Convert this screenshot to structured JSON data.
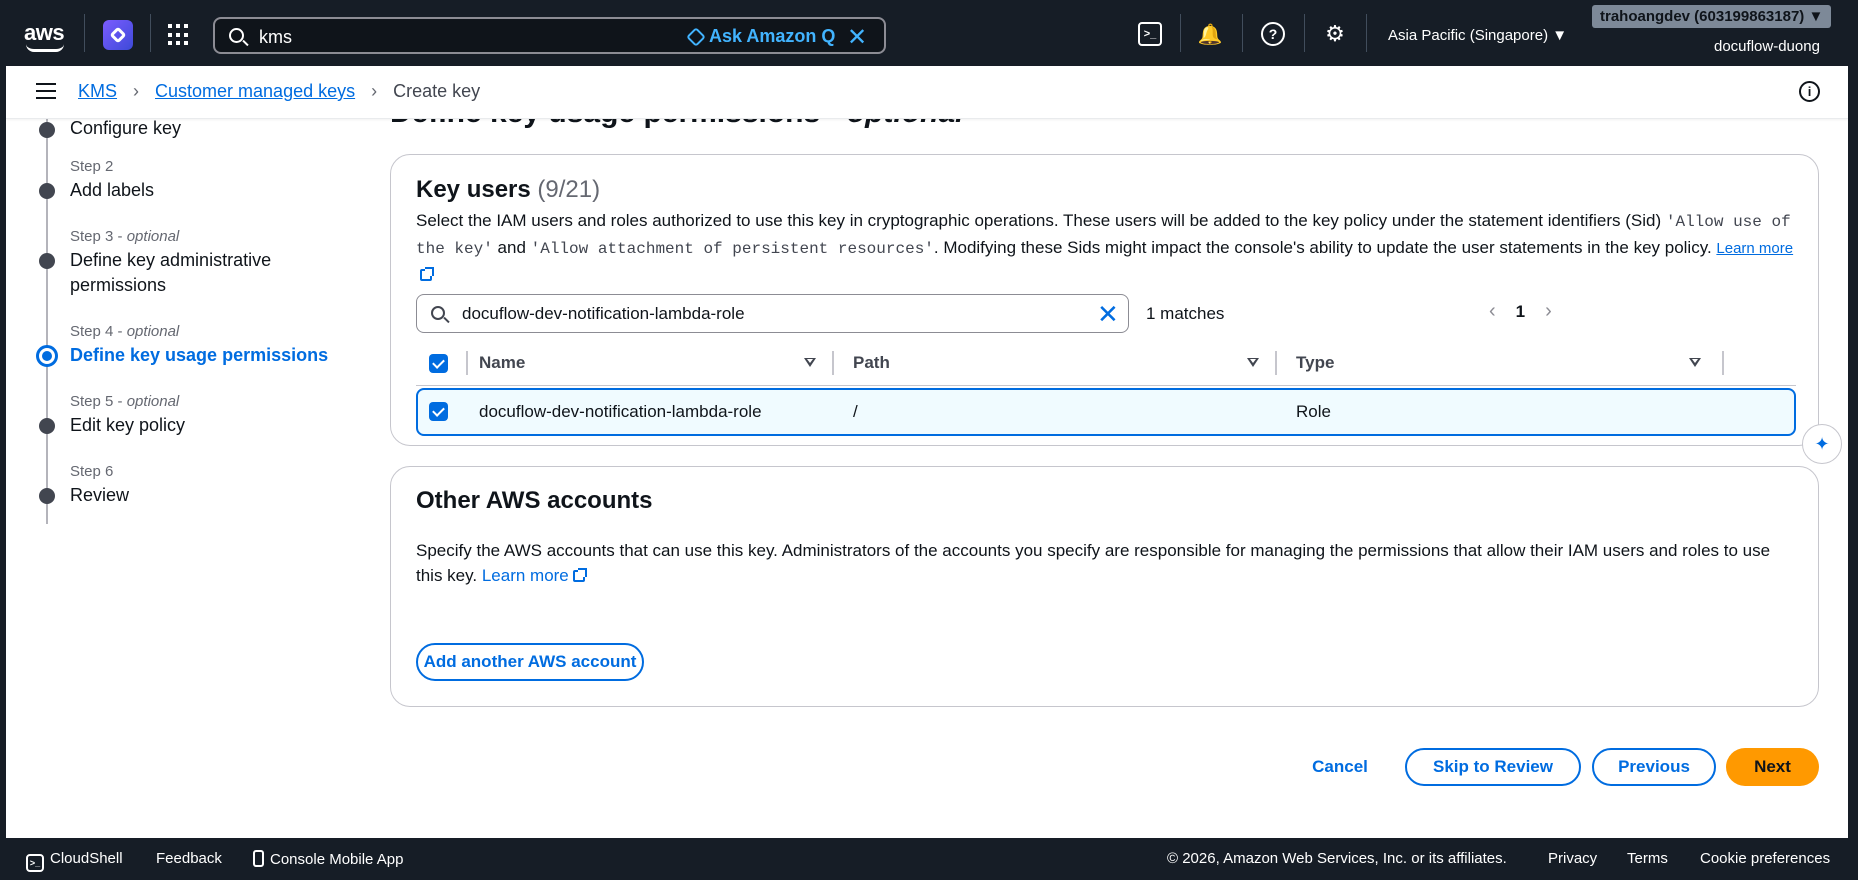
{
  "topnav": {
    "logo_text": "aws",
    "search_value": "kms",
    "ask_q": "Ask Amazon Q",
    "region": "Asia Pacific (Singapore)",
    "account": "trahoangdev (603199863187)",
    "user": "docuflow-duong",
    "icons": [
      "cloudshell-icon",
      "bell-icon",
      "help-icon",
      "gear-icon"
    ]
  },
  "breadcrumb": {
    "items": [
      "KMS",
      "Customer managed keys"
    ],
    "current": "Create key"
  },
  "steps": [
    {
      "num": "",
      "optional": "",
      "title": "Configure key"
    },
    {
      "num": "Step 2",
      "optional": "",
      "title": "Add labels"
    },
    {
      "num": "Step 3",
      "optional": "optional",
      "title": "Define key administrative permissions"
    },
    {
      "num": "Step 4",
      "optional": "optional",
      "title": "Define key usage permissions"
    },
    {
      "num": "Step 5",
      "optional": "optional",
      "title": "Edit key policy"
    },
    {
      "num": "Step 6",
      "optional": "",
      "title": "Review"
    }
  ],
  "step_sep": " - ",
  "page": {
    "heading": "Define key usage permissions - ",
    "heading_optional": "optional"
  },
  "key_users": {
    "title": "Key users",
    "count": "(9/21)",
    "desc_1": "Select the IAM users and roles authorized to use this key in cryptographic operations. These users will be added to the key policy under the statement identifiers (Sid) ",
    "code_1": "'Allow use of the key'",
    "desc_2": " and ",
    "code_2": "'Allow attachment of persistent resources'",
    "desc_3": ". Modifying these Sids might impact the console's ability to update the user statements in the key policy. ",
    "learn_more": "Learn more",
    "filter_value": "docuflow-dev-notification-lambda-role",
    "matches": "1 matches",
    "page": "1",
    "columns": [
      "Name",
      "Path",
      "Type"
    ],
    "rows": [
      {
        "name": "docuflow-dev-notification-lambda-role",
        "path": "/",
        "type": "Role",
        "selected": true
      }
    ]
  },
  "other_accounts": {
    "title": "Other AWS accounts",
    "desc": "Specify the AWS accounts that can use this key. Administrators of the accounts you specify are responsible for managing the permissions that allow their IAM users and roles to use this key. ",
    "learn_more": "Learn more",
    "add_button": "Add another AWS account"
  },
  "actions": {
    "cancel": "Cancel",
    "skip": "Skip to Review",
    "previous": "Previous",
    "next": "Next"
  },
  "footer": {
    "cloudshell": "CloudShell",
    "feedback": "Feedback",
    "mobile": "Console Mobile App",
    "copyright": "© 2026, Amazon Web Services, Inc. or its affiliates.",
    "privacy": "Privacy",
    "terms": "Terms",
    "cookies": "Cookie preferences"
  },
  "colors": {
    "nav_bg": "#161d26",
    "link": "#006ce0",
    "primary": "#ff9900"
  }
}
